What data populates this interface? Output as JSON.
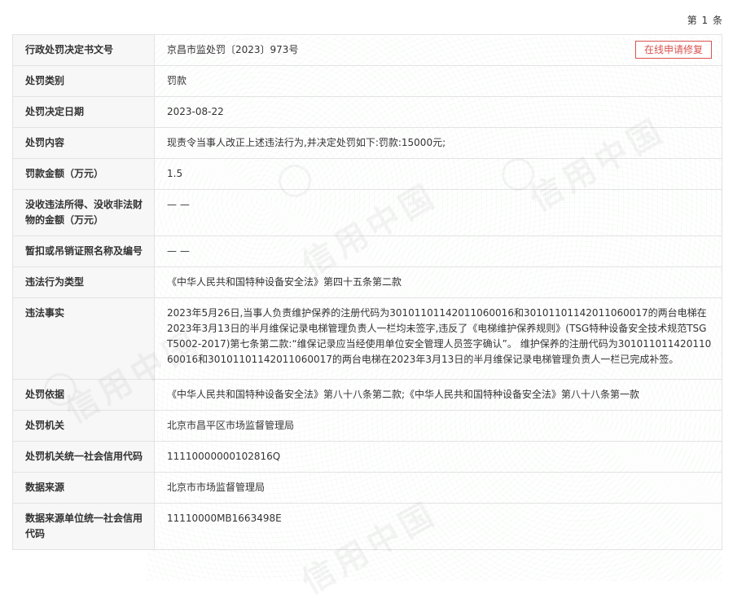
{
  "page_counter": "第 1 条",
  "watermark_text": "信用中国",
  "repair_button": "在线申请修复",
  "rows": [
    {
      "label": "行政处罚决定书文号",
      "value": "京昌市监处罚〔2023〕973号"
    },
    {
      "label": "处罚类别",
      "value": "罚款"
    },
    {
      "label": "处罚决定日期",
      "value": "2023-08-22"
    },
    {
      "label": "处罚内容",
      "value": "现责令当事人改正上述违法行为,并决定处罚如下:罚款:15000元;"
    },
    {
      "label": "罚款金额（万元）",
      "value": "1.5"
    },
    {
      "label": "没收违法所得、没收非法财物的金额（万元）",
      "value": "— —"
    },
    {
      "label": "暂扣或吊销证照名称及编号",
      "value": "— —"
    },
    {
      "label": "违法行为类型",
      "value": "《中华人民共和国特种设备安全法》第四十五条第二款"
    },
    {
      "label": "违法事实",
      "value": "2023年5月26日,当事人负责维护保养的注册代码为30101101142011060016和30101101142011060017的两台电梯在2023年3月13日的半月维保记录电梯管理负责人一栏均未签字,违反了《电梯维护保养规则》(TSG特种设备安全技术规范TSG T5002-2017)第七条第二款:“维保记录应当经使用单位安全管理人员签字确认”。 维护保养的注册代码为30101101142011060016和30101101142011060017的两台电梯在2023年3月13日的半月维保记录电梯管理负责人一栏已完成补签。"
    },
    {
      "label": "处罚依据",
      "value": "《中华人民共和国特种设备安全法》第八十八条第二款;《中华人民共和国特种设备安全法》第八十八条第一款"
    },
    {
      "label": "处罚机关",
      "value": "北京市昌平区市场监督管理局"
    },
    {
      "label": "处罚机关统一社会信用代码",
      "value": "11110000000102816Q"
    },
    {
      "label": "数据来源",
      "value": "北京市市场监督管理局"
    },
    {
      "label": "数据来源单位统一社会信用代码",
      "value": "11110000MB1663498E"
    }
  ]
}
